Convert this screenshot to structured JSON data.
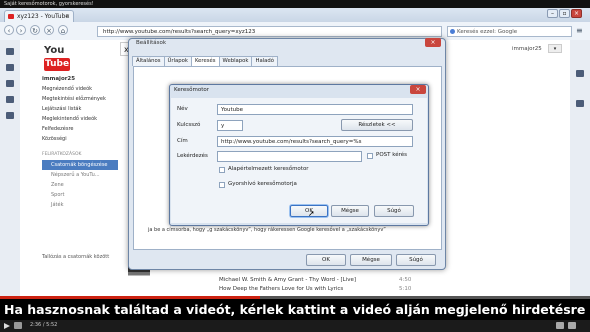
{
  "video_title_overlay": "Saját keresőmotorok, gyorskeresés!",
  "browser": {
    "tab_title": "xyz123 - YouTube",
    "tab_close": "×",
    "url": "http://www.youtube.com/results?search_query=xyz123",
    "search_placeholder": "Keresés ezzel: Google",
    "window_buttons": [
      "–",
      "▫",
      "×"
    ]
  },
  "youtube": {
    "logo_text": "You",
    "logo_tube": "Tube",
    "search_value": "xyz12",
    "username": "immajor25",
    "nav": [
      {
        "label": "immajor25",
        "type": "hdr"
      },
      {
        "label": "Megnézendő videók",
        "type": "item"
      },
      {
        "label": "Megtekintési előzmények",
        "type": "item"
      },
      {
        "label": "Lejátszási listák",
        "type": "item"
      },
      {
        "label": "Meglekintendő videók",
        "type": "item"
      },
      {
        "label": "Felfedezésre",
        "type": "item"
      },
      {
        "label": "Közösségi",
        "type": "item"
      },
      {
        "label": "FELIRATKOZÁSOK",
        "type": "sec"
      },
      {
        "label": "Csatornák böngészése",
        "type": "sel"
      },
      {
        "label": "Népszerű a YouTu...",
        "type": "sub"
      },
      {
        "label": "Zene",
        "type": "sub"
      },
      {
        "label": "Sport",
        "type": "sub"
      },
      {
        "label": "Játék",
        "type": "sub"
      }
    ],
    "add_channels": "Tallózás a csatornák között",
    "results": [
      {
        "title": "Michael W. Smith & Amy Grant - Thy Word - [Live]",
        "duration": "4:50"
      },
      {
        "title": "How Deep the Fathers Love for Us with Lyrics",
        "duration": "5:10"
      }
    ]
  },
  "settings_dialog": {
    "title": "Beállítások",
    "close": "×",
    "tabs": [
      "Általános",
      "Űrlapok",
      "Keresés",
      "Weblapok",
      "Haladó"
    ],
    "active_tab": "Keresés",
    "hint_text": "ja be a címsorba, hogy „g szakácskönyv”, hogy rákeressen Google keresővel a „szakácskönyv”",
    "ok": "OK",
    "cancel": "Mégse",
    "help": "Súgó"
  },
  "engine_dialog": {
    "title": "Keresőmotor",
    "close": "×",
    "name_label": "Név",
    "name_value": "Youtube",
    "keyword_label": "Kulcsszó",
    "keyword_value": "y",
    "details_button": "Részletek <<",
    "address_label": "Cím",
    "address_value": "http://www.youtube.com/results?search_query=%s",
    "query_label": "Lekérdezés",
    "query_value": "",
    "post_label": "POST kérés",
    "default_label": "Alapértelmezett keresőmotor",
    "speeddial_label": "Gyorshívó keresőmotorja",
    "ok": "OK",
    "cancel": "Mégse",
    "help": "Súgó"
  },
  "video": {
    "subtitle": "Ha hasznosnak találtad a videót, kérlek kattint a videó alján megjelenő hirdetésre :)",
    "time": "2:36 / 5:52",
    "progress": 0.44
  }
}
